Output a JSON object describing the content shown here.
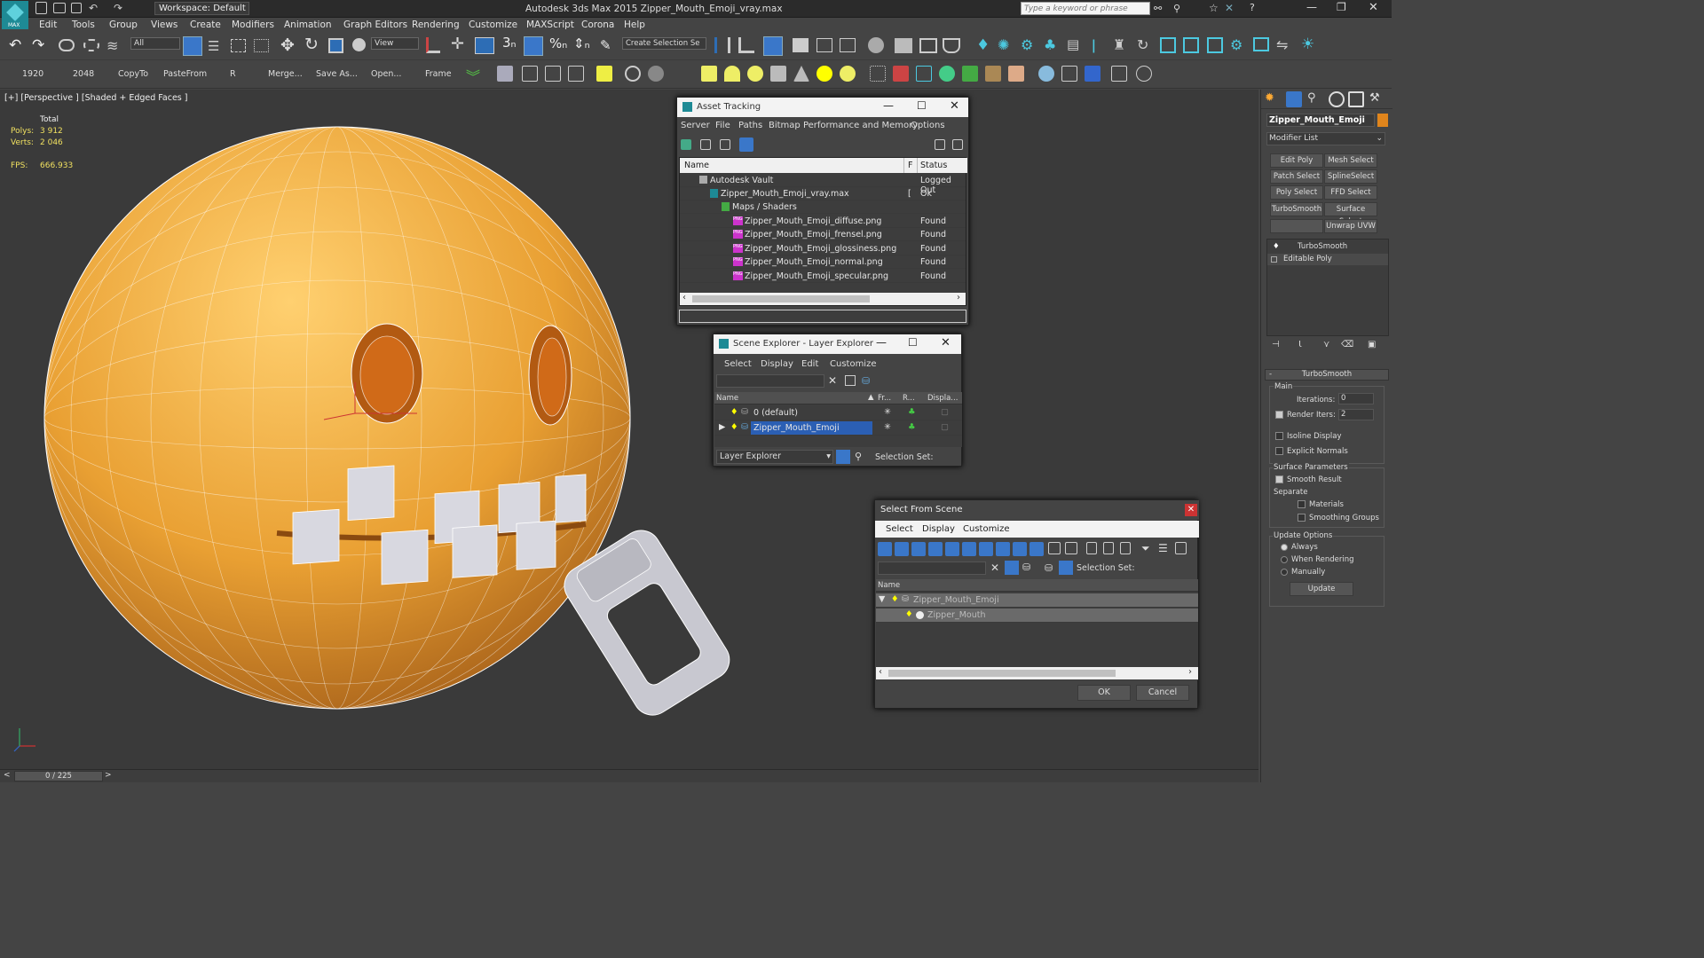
{
  "titlebar": {
    "workspace": "Workspace: Default",
    "title": "Autodesk 3ds Max  2015    Zipper_Mouth_Emoji_vray.max",
    "search_placeholder": "Type a keyword or phrase"
  },
  "menu": [
    "Edit",
    "Tools",
    "Group",
    "Views",
    "Create",
    "Modifiers",
    "Animation",
    "Graph Editors",
    "Rendering",
    "Customize",
    "MAXScript",
    "Corona",
    "Help"
  ],
  "toolbar1": {
    "selection_filter": "All",
    "ref_coord": "View",
    "named_selection": "Create Selection Se",
    "snap_angle": "3"
  },
  "toolbar2": {
    "buttons": [
      "1920",
      "2048",
      "CopyTo",
      "PasteFrom",
      "R",
      "Merge...",
      "Save As...",
      "Open...",
      "Frame"
    ]
  },
  "viewport": {
    "label": "[+] [Perspective ] [Shaded + Edged Faces ]",
    "stats": {
      "total_label": "Total",
      "polys_label": "Polys:",
      "polys": "3 912",
      "verts_label": "Verts:",
      "verts": "2 046",
      "fps_label": "FPS:",
      "fps": "666.933"
    }
  },
  "asset_tracking": {
    "title": "Asset Tracking",
    "menu": [
      "Server",
      "File",
      "Paths",
      "Bitmap Performance and Memory",
      "Options"
    ],
    "columns": [
      "Name",
      "F",
      "Status"
    ],
    "rows": [
      {
        "name": "Autodesk Vault",
        "f": "",
        "status": "Logged Out"
      },
      {
        "name": "Zipper_Mouth_Emoji_vray.max",
        "f": "[",
        "status": "Ok"
      },
      {
        "name": "Maps / Shaders",
        "f": "",
        "status": ""
      },
      {
        "name": "Zipper_Mouth_Emoji_diffuse.png",
        "f": "",
        "status": "Found"
      },
      {
        "name": "Zipper_Mouth_Emoji_frensel.png",
        "f": "",
        "status": "Found"
      },
      {
        "name": "Zipper_Mouth_Emoji_glossiness.png",
        "f": "",
        "status": "Found"
      },
      {
        "name": "Zipper_Mouth_Emoji_normal.png",
        "f": "",
        "status": "Found"
      },
      {
        "name": "Zipper_Mouth_Emoji_specular.png",
        "f": "",
        "status": "Found"
      }
    ]
  },
  "scene_explorer": {
    "title": "Scene Explorer - Layer Explorer",
    "menu": [
      "Select",
      "Display",
      "Edit",
      "Customize"
    ],
    "columns": [
      "Name",
      "Fr...",
      "R...",
      "Displa..."
    ],
    "rows": [
      "0 (default)",
      "Zipper_Mouth_Emoji"
    ],
    "footer_dropdown": "Layer Explorer",
    "selection_set_label": "Selection Set:"
  },
  "select_from_scene": {
    "title": "Select From Scene",
    "menu": [
      "Select",
      "Display",
      "Customize"
    ],
    "selection_set_label": "Selection Set:",
    "column": "Name",
    "rows": [
      "Zipper_Mouth_Emoji",
      "Zipper_Mouth"
    ],
    "ok": "OK",
    "cancel": "Cancel"
  },
  "command_panel": {
    "object_name": "Zipper_Mouth_Emoji",
    "modifier_list": "Modifier List",
    "modifier_buttons": [
      "Edit Poly",
      "Mesh Select",
      "Patch Select",
      "SplineSelect",
      "Poly Select",
      "FFD Select",
      "TurboSmooth",
      "Surface Select",
      "",
      "Unwrap UVW"
    ],
    "stack": [
      "TurboSmooth",
      "Editable Poly"
    ],
    "rollout_title": "TurboSmooth",
    "main_label": "Main",
    "iterations_label": "Iterations:",
    "iterations": "0",
    "render_iters_label": "Render Iters:",
    "render_iters": "2",
    "isoline": "Isoline Display",
    "explicit_normals": "Explicit Normals",
    "surface_params": "Surface Parameters",
    "smooth_result": "Smooth Result",
    "separate": "Separate",
    "materials": "Materials",
    "smoothing_groups": "Smoothing Groups",
    "update_options": "Update Options",
    "always": "Always",
    "when_rendering": "When Rendering",
    "manually": "Manually",
    "update": "Update"
  },
  "timeline": {
    "frame": "0 / 225"
  },
  "colors": {
    "emoji": "#e9a033",
    "wire": "#ffffff",
    "accent": "#3a77c9"
  }
}
